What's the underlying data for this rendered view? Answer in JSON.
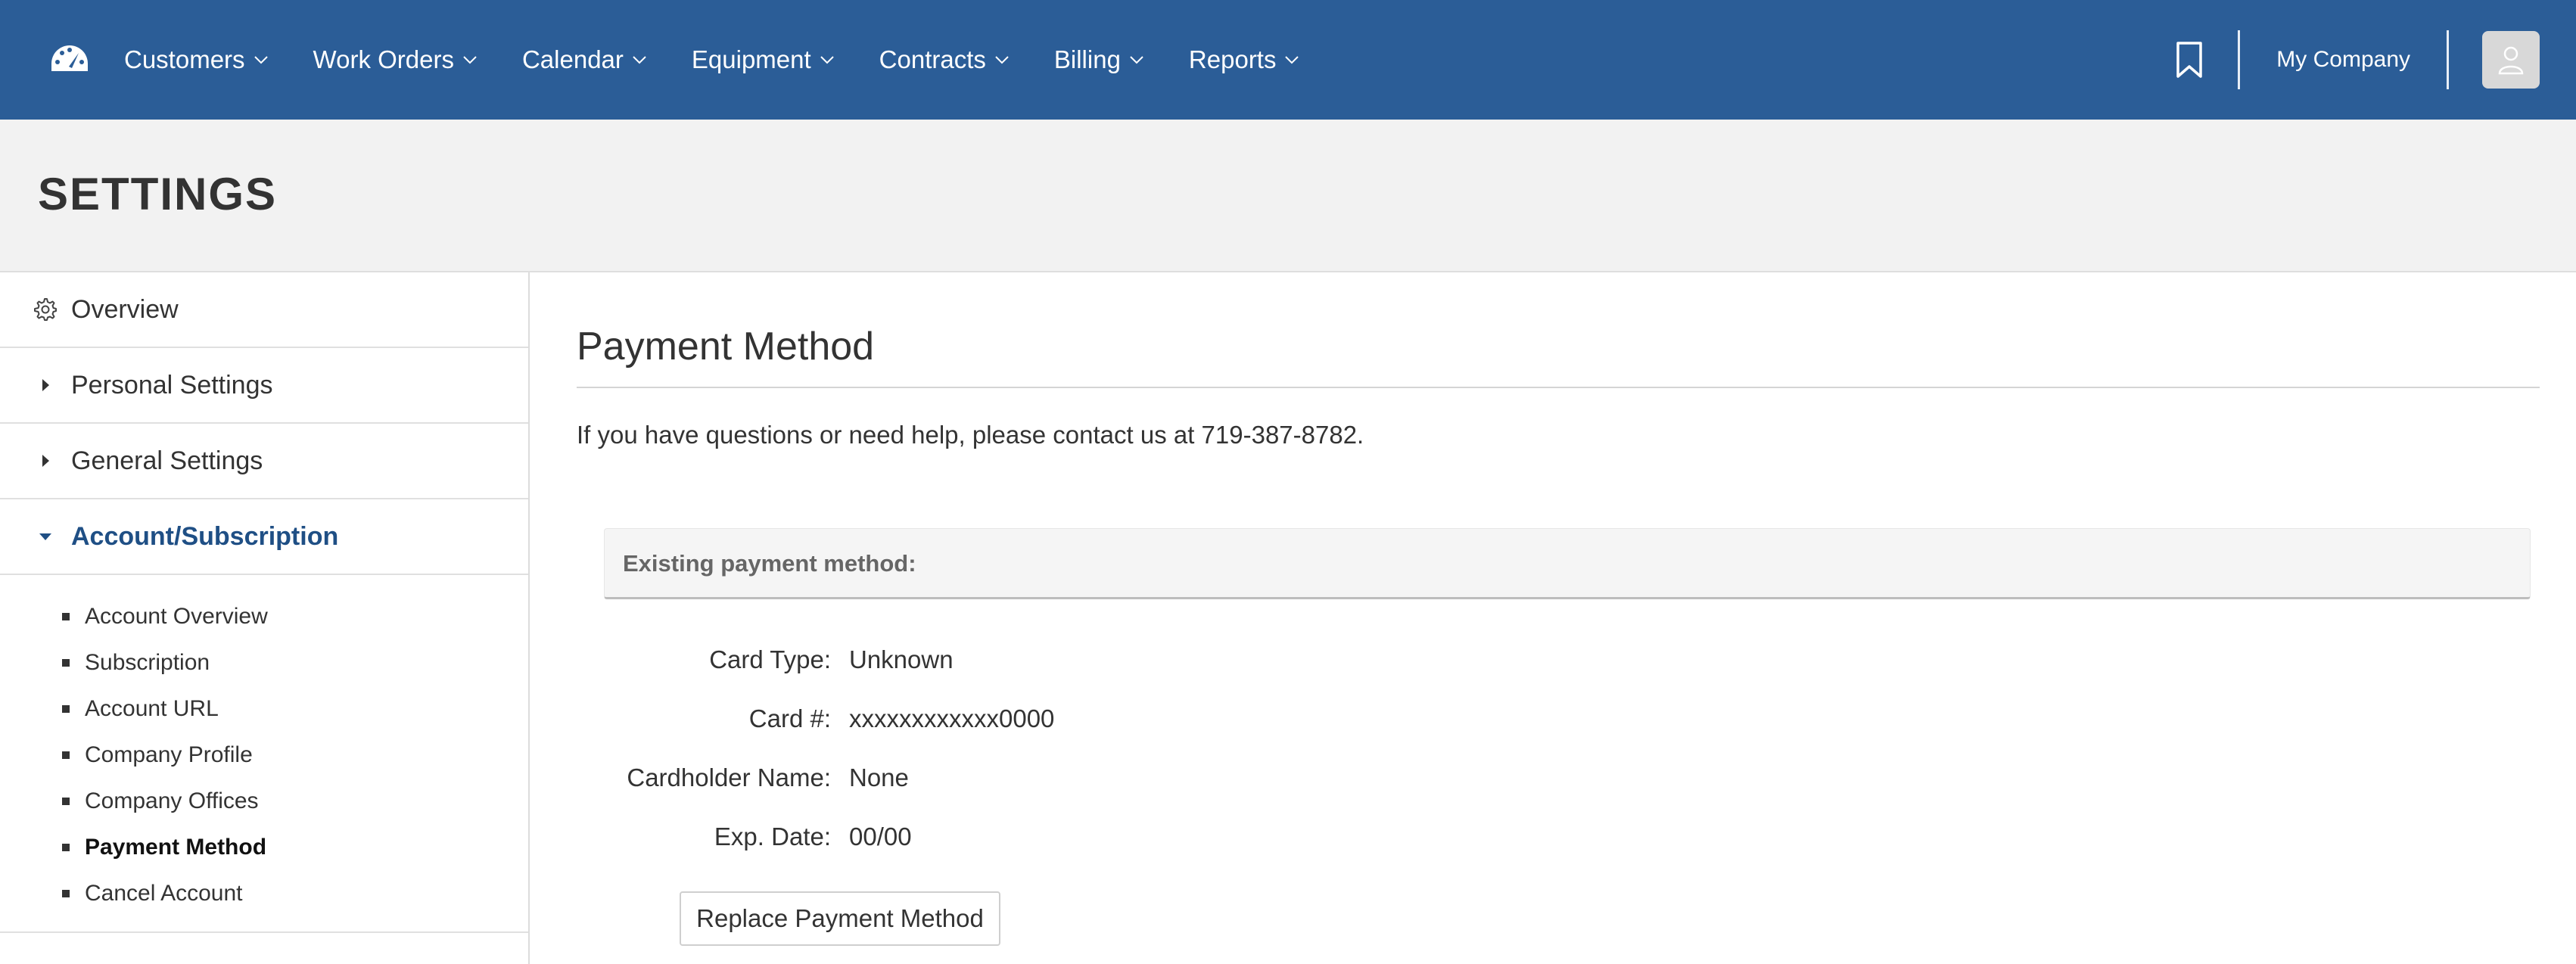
{
  "nav": {
    "items": [
      {
        "label": "Customers"
      },
      {
        "label": "Work Orders"
      },
      {
        "label": "Calendar"
      },
      {
        "label": "Equipment"
      },
      {
        "label": "Contracts"
      },
      {
        "label": "Billing"
      },
      {
        "label": "Reports"
      }
    ],
    "company": "My Company",
    "logo_icon": "speedometer-icon",
    "bookmark_icon": "bookmark-icon",
    "avatar_icon": "user-icon"
  },
  "page": {
    "title": "SETTINGS"
  },
  "sidebar": {
    "items": [
      {
        "label": "Overview",
        "icon": "gear-icon"
      },
      {
        "label": "Personal Settings",
        "icon": "caret-right-icon"
      },
      {
        "label": "General Settings",
        "icon": "caret-right-icon"
      },
      {
        "label": "Account/Subscription",
        "icon": "caret-down-icon"
      }
    ],
    "subitems": [
      {
        "label": "Account Overview"
      },
      {
        "label": "Subscription"
      },
      {
        "label": "Account URL"
      },
      {
        "label": "Company Profile"
      },
      {
        "label": "Company Offices"
      },
      {
        "label": "Payment Method"
      },
      {
        "label": "Cancel Account"
      }
    ]
  },
  "main": {
    "heading": "Payment Method",
    "help": "If you have questions or need help, please contact us at 719-387-8782.",
    "existing_label": "Existing payment method:",
    "fields": [
      {
        "label": "Card Type:",
        "value": "Unknown"
      },
      {
        "label": "Card #:",
        "value": "xxxxxxxxxxxx0000"
      },
      {
        "label": "Cardholder Name:",
        "value": "None"
      },
      {
        "label": "Exp. Date:",
        "value": "00/00"
      }
    ],
    "replace_button": "Replace Payment Method"
  },
  "colors": {
    "nav_bg": "#2b5d97",
    "active_link": "#1f4f85"
  }
}
